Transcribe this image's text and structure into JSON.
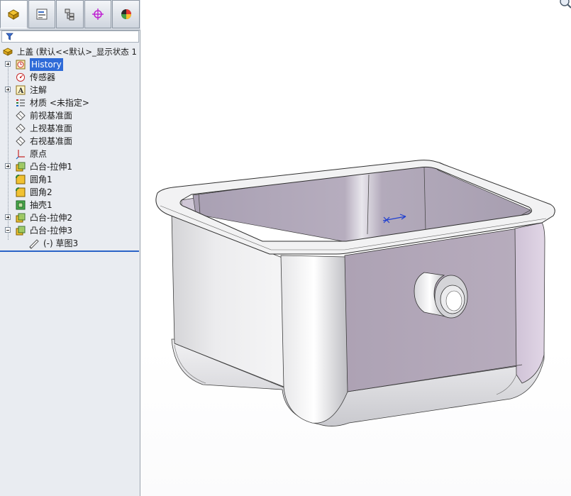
{
  "tabs": [
    {
      "name": "feature-manager-tab",
      "icon": "feature-tree-icon"
    },
    {
      "name": "property-manager-tab",
      "icon": "property-icon"
    },
    {
      "name": "configuration-manager-tab",
      "icon": "configuration-icon"
    },
    {
      "name": "dimxpert-tab",
      "icon": "crosshair-icon"
    },
    {
      "name": "display-manager-tab",
      "icon": "appearance-icon"
    }
  ],
  "filter": {
    "icon": "filter-icon"
  },
  "tree": {
    "root": {
      "label": "上盖  (默认<<默认>_显示状态 1",
      "icon": "part-icon"
    },
    "items": [
      {
        "label": "History",
        "icon": "history-icon",
        "expand": "plus",
        "selected": true
      },
      {
        "label": "传感器",
        "icon": "sensors-icon",
        "expand": "none"
      },
      {
        "label": "注解",
        "icon": "annotations-icon",
        "expand": "plus"
      },
      {
        "label": "材质 <未指定>",
        "icon": "material-icon",
        "expand": "none"
      },
      {
        "label": "前视基准面",
        "icon": "plane-icon",
        "expand": "none"
      },
      {
        "label": "上视基准面",
        "icon": "plane-icon",
        "expand": "none"
      },
      {
        "label": "右视基准面",
        "icon": "plane-icon",
        "expand": "none"
      },
      {
        "label": "原点",
        "icon": "origin-icon",
        "expand": "none"
      },
      {
        "label": "凸台-拉伸1",
        "icon": "extrude-icon",
        "expand": "plus"
      },
      {
        "label": "圆角1",
        "icon": "fillet-icon",
        "expand": "none"
      },
      {
        "label": "圆角2",
        "icon": "fillet-icon",
        "expand": "none"
      },
      {
        "label": "抽壳1",
        "icon": "shell-icon",
        "expand": "none"
      },
      {
        "label": "凸台-拉伸2",
        "icon": "extrude-icon",
        "expand": "plus"
      },
      {
        "label": "凸台-拉伸3",
        "icon": "extrude-icon",
        "expand": "minus"
      },
      {
        "label": "(-) 草图3",
        "icon": "sketch-icon",
        "expand": "child"
      }
    ]
  },
  "model": {
    "name": "sink-shell-model",
    "icon": "triad-axis-icon"
  },
  "colors": {
    "shell_face": "#e3e3e3",
    "inner_face": "#b0a6b8",
    "accent": "#2a63c7"
  }
}
